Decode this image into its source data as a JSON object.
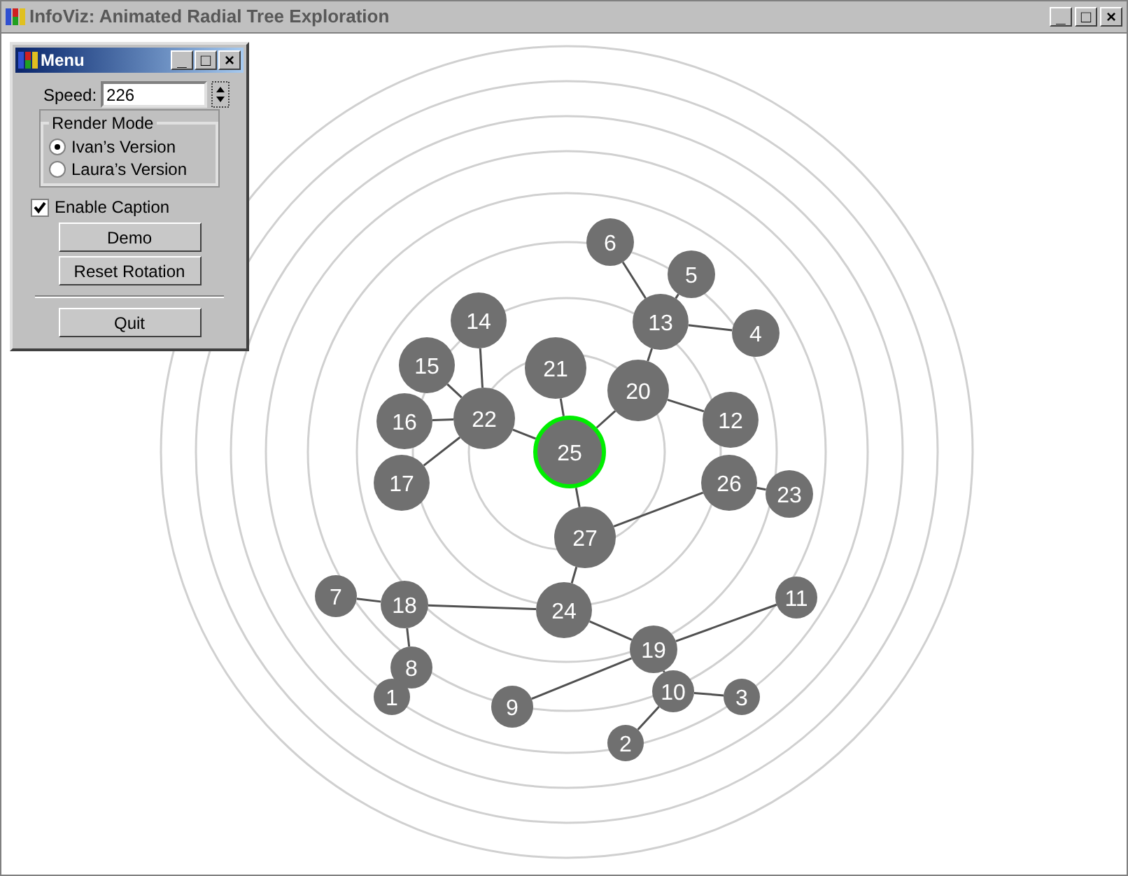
{
  "window": {
    "title": "InfoViz: Animated Radial Tree Exploration",
    "buttons": [
      "_",
      "□",
      "×"
    ]
  },
  "menu": {
    "title": "Menu",
    "buttons": [
      "_",
      "□",
      "×"
    ],
    "speed_label": "Speed:",
    "speed_value": "226",
    "render_mode": {
      "title": "Render Mode",
      "options": [
        {
          "label": "Ivan’s Version",
          "selected": true
        },
        {
          "label": "Laura’s Version",
          "selected": false
        }
      ]
    },
    "enable_caption": {
      "label": "Enable Caption",
      "checked": true
    },
    "actions": [
      "Demo",
      "Reset Rotation"
    ],
    "quit": "Quit"
  },
  "tree": {
    "label": "25",
    "selected": true,
    "children": [
      {
        "label": "21",
        "selected": false
      },
      {
        "label": "22",
        "selected": false,
        "children": [
          {
            "label": "14",
            "selected": false
          },
          {
            "label": "15",
            "selected": false
          },
          {
            "label": "16",
            "selected": false
          },
          {
            "label": "17",
            "selected": false
          }
        ]
      },
      {
        "label": "20",
        "selected": false,
        "children": [
          {
            "label": "13",
            "selected": false,
            "children": [
              {
                "label": "6",
                "selected": false
              },
              {
                "label": "5",
                "selected": false
              },
              {
                "label": "4",
                "selected": false
              }
            ]
          },
          {
            "label": "12",
            "selected": false
          }
        ]
      },
      {
        "label": "27",
        "selected": false,
        "children": [
          {
            "label": "26",
            "selected": false,
            "children": [
              {
                "label": "23",
                "selected": false
              }
            ]
          },
          {
            "label": "24",
            "selected": false,
            "children": [
              {
                "label": "18",
                "selected": false,
                "children": [
                  {
                    "label": "7",
                    "selected": false
                  },
                  {
                    "label": "8",
                    "selected": false,
                    "children": [
                      {
                        "label": "1",
                        "selected": false
                      }
                    ]
                  }
                ]
              },
              {
                "label": "19",
                "selected": false,
                "children": [
                  {
                    "label": "11",
                    "selected": false
                  },
                  {
                    "label": "9",
                    "selected": false
                  },
                  {
                    "label": "10",
                    "selected": false,
                    "children": [
                      {
                        "label": "3",
                        "selected": false
                      },
                      {
                        "label": "2",
                        "selected": false
                      }
                    ]
                  }
                ]
              }
            ]
          }
        ]
      }
    ]
  }
}
